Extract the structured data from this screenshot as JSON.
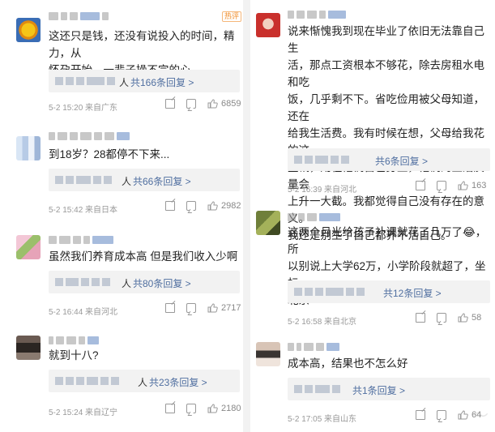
{
  "left": [
    {
      "hot_badge": "热评",
      "text": [
        "这还只是钱，还没有说投入的时间，精力，从",
        "怀孕开始，一辈子操不完的心"
      ],
      "reply": "共166条回复 >",
      "reply_prefix": "人",
      "meta": "5-2 15:20  来自广东",
      "likes": "6859"
    },
    {
      "text": [
        "到18岁？28都停不下来..."
      ],
      "reply": "共66条回复 >",
      "reply_prefix": "人",
      "meta": "5-2 15:42  来自日本",
      "likes": "2982"
    },
    {
      "text": [
        "虽然我们养育成本高 但是我们收入少啊"
      ],
      "reply": "共80条回复 >",
      "reply_prefix": "人",
      "meta": "5-2 16:44  来自河北",
      "likes": "2717"
    },
    {
      "text": [
        "就到十八?"
      ],
      "reply": "共23条回复 >",
      "reply_prefix": "人",
      "meta": "5-2 15:24  来自辽宁",
      "likes": "2180"
    }
  ],
  "right": [
    {
      "text": [
        "说来惭愧我到现在毕业了依旧无法靠自己生",
        "活，那点工资根本不够花，除去房租水电和吃",
        "饭，几乎剩不下。省吃俭用被父母知道，还在",
        "给我生活费。我有时候在想，父母给我花的这",
        "些钱，用在他们自己身上，他们的生活质量会",
        "上升一大截。我都觉得自己没有存在的意义。",
        "我还是别生了自己都养不活自己。"
      ],
      "reply": "共6条回复 >",
      "meta": "5-2 16:39  来自河北",
      "likes": "163"
    },
    {
      "text": [
        "这两个月光给孩子补课就花了几万了😂，所",
        "以别说上大学62万，小学阶段就超了，坐标",
        "北京"
      ],
      "reply": "共12条回复 >",
      "meta": "5-2 16:58  来自北京",
      "likes": "58"
    },
    {
      "text": [
        "成本高，结果也不怎么好"
      ],
      "reply": "共1条回复 >",
      "meta": "5-2 17:05  来自山东",
      "likes": "64"
    }
  ],
  "icons": {
    "share": "share-icon",
    "comment": "comment-icon",
    "like": "thumbs-up-icon"
  },
  "colors": {
    "link": "#506fa0",
    "hot": "#f08a24",
    "meta": "#999999"
  }
}
